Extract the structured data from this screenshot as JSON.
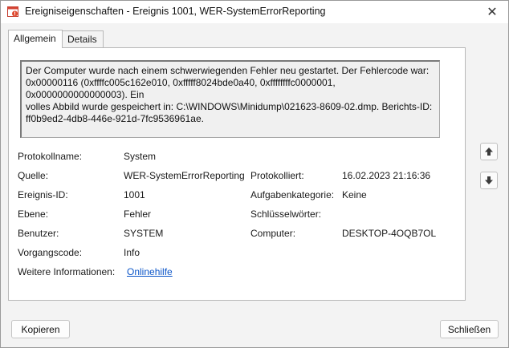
{
  "window": {
    "title": "Ereigniseigenschaften - Ereignis 1001, WER-SystemErrorReporting",
    "close_glyph": "✕"
  },
  "tabs": [
    {
      "label": "Allgemein",
      "active": true
    },
    {
      "label": "Details",
      "active": false
    }
  ],
  "description": "Der Computer wurde nach einem schwerwiegenden Fehler neu gestartet. Der Fehlercode war:\n0x00000116 (0xffffc005c162e010, 0xfffff8024bde0a40, 0xffffffffc0000001, 0x0000000000000003). Ein\nvolles Abbild wurde gespeichert in: C:\\WINDOWS\\Minidump\\021623-8609-02.dmp. Berichts-ID:\nff0b9ed2-4db8-446e-921d-7fc9536961ae.",
  "fields": {
    "log_name": {
      "label": "Protokollname:",
      "value": "System"
    },
    "source": {
      "label": "Quelle:",
      "value": "WER-SystemErrorReporting"
    },
    "logged": {
      "label": "Protokolliert:",
      "value": "16.02.2023 21:16:36"
    },
    "event_id": {
      "label": "Ereignis-ID:",
      "value": "1001"
    },
    "task_category": {
      "label": "Aufgabenkategorie:",
      "value": "Keine"
    },
    "level": {
      "label": "Ebene:",
      "value": "Fehler"
    },
    "keywords": {
      "label": "Schlüsselwörter:",
      "value": ""
    },
    "user": {
      "label": "Benutzer:",
      "value": "SYSTEM"
    },
    "computer": {
      "label": "Computer:",
      "value": "DESKTOP-4OQB7OL"
    },
    "opcode": {
      "label": "Vorgangscode:",
      "value": "Info"
    },
    "more_info": {
      "label": "Weitere Informationen:",
      "value": "Onlinehilfe"
    }
  },
  "buttons": {
    "copy": "Kopieren",
    "close": "Schließen"
  },
  "icons": {
    "app": "event-viewer-icon",
    "up": "arrow-up-icon",
    "down": "arrow-down-icon"
  }
}
